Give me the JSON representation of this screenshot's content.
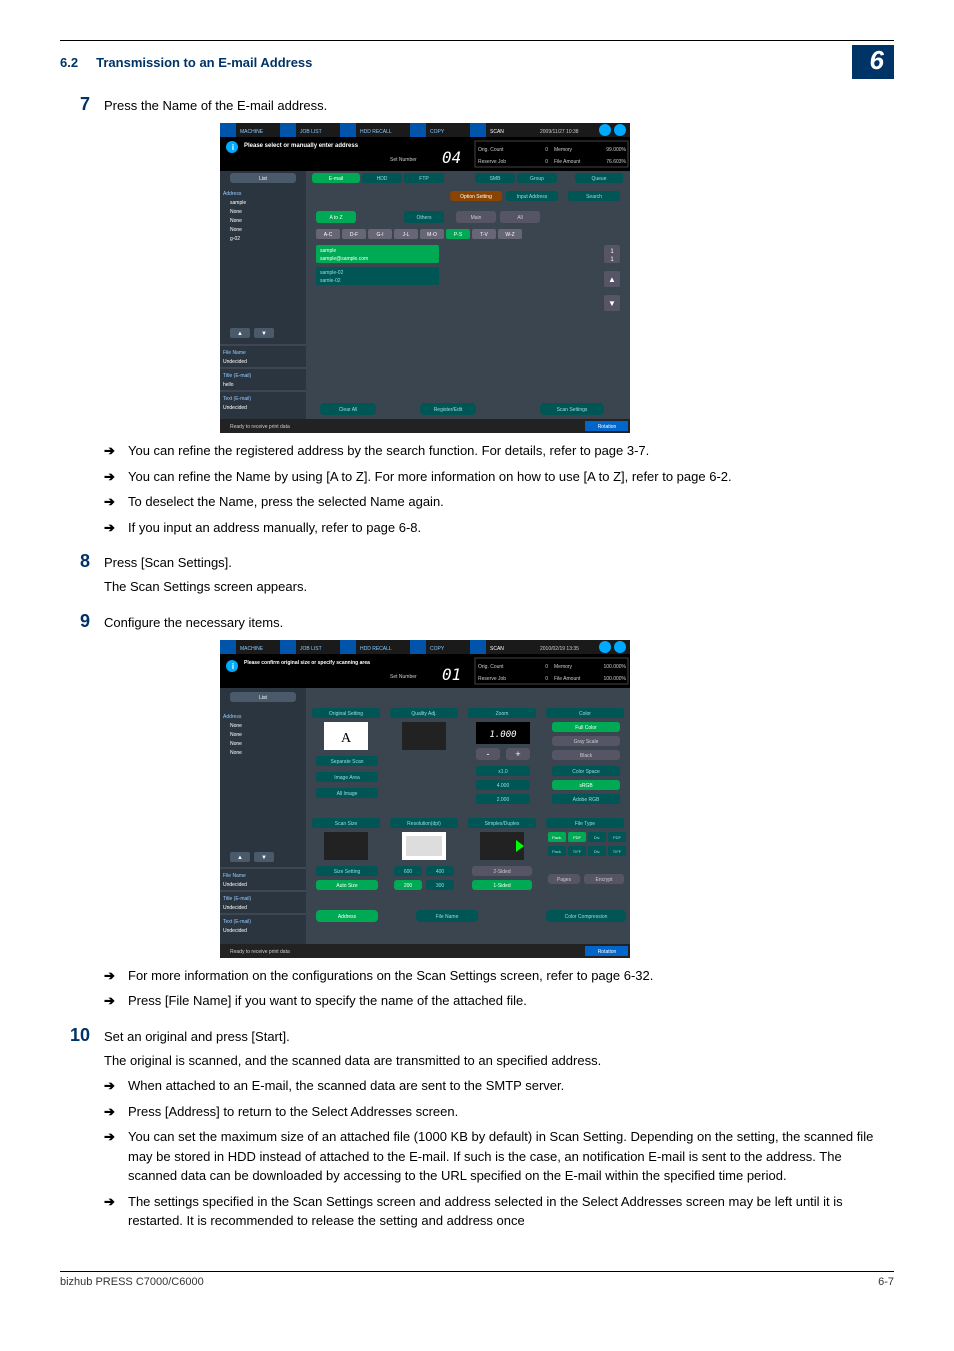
{
  "header": {
    "section_num": "6.2",
    "section_title": "Transmission to an E-mail Address",
    "chapter": "6"
  },
  "steps": [
    {
      "num": "7",
      "text": "Press the Name of the E-mail address.",
      "arrows": [
        "You can refine the registered address by the search function. For details, refer to page 3-7.",
        "You can refine the Name by using [A to Z]. For more information on how to use [A to Z], refer to page 6-2.",
        "To deselect the Name, press the selected Name again.",
        "If you input an address manually, refer to page 6-8."
      ]
    },
    {
      "num": "8",
      "text": "Press [Scan Settings].",
      "desc": "The Scan Settings screen appears."
    },
    {
      "num": "9",
      "text": "Configure the necessary items.",
      "arrows": [
        "For more information on the configurations on the Scan Settings screen, refer to page 6-32.",
        "Press [File Name] if you want to specify the name of the attached file."
      ]
    },
    {
      "num": "10",
      "text": "Set an original and press [Start].",
      "desc": "The original is scanned, and the scanned data are transmitted to an specified address.",
      "arrows": [
        "When attached to an E-mail, the scanned data are sent to the SMTP server.",
        "Press [Address] to return to the Select Addresses screen.",
        " You can set the maximum size of an attached file (1000 KB by default) in Scan Setting. Depending on the setting, the scanned file may be stored in HDD instead of attached to the E-mail. If such is the case, an notification E-mail is sent to the address. The scanned data can be downloaded by accessing to the URL specified on the E-mail within the specified time period.",
        "The settings specified in the Scan Settings screen and address selected in the Select Addresses screen may be left until it is restarted. It is recommended to release the setting and address once"
      ]
    }
  ],
  "screenshot1": {
    "topbar": {
      "machine": "MACHINE",
      "joblist": "JOB LIST",
      "hddrecall": "HDD RECALL",
      "copy": "COPY",
      "scan": "SCAN",
      "datetime": "2009/11/27 10:38"
    },
    "info_msg": "Please select or manually enter address",
    "set_number_label": "Set Number",
    "set_number_value": "04",
    "counts": {
      "orig_label": "Orig. Count",
      "orig_val": "0",
      "reserve_label": "Reserve Job",
      "reserve_val": "0",
      "mem_label": "Memory",
      "mem_val": "99.000%",
      "file_label": "File Amount",
      "file_val": "76.603%"
    },
    "list_btn": "List",
    "left_labels": {
      "address": "Address",
      "sample": "sample",
      "none1": "None",
      "none2": "None",
      "none3": "None",
      "g02": "g-02",
      "file_name_l": "File Name",
      "file_name_v": "Undecided",
      "title_l": "Title (E-mail)",
      "title_v": "hello",
      "text_l": "Text (E-mail)",
      "text_v": "Undecided"
    },
    "tabs": {
      "email": "E-mail",
      "hdd": "HDD",
      "ftp": "FTP",
      "smb": "SMB",
      "group": "Group",
      "queue": "Queue"
    },
    "option_setting": "Option Setting",
    "input_address": "Input Address",
    "search": "Search",
    "cat_tabs": {
      "atoz": "A to Z",
      "others": "Others",
      "main": "Main",
      "all": "All"
    },
    "alpha": {
      "ac": "A-C",
      "df": "D-F",
      "gi": "G-I",
      "jl": "J-L",
      "mo": "M-O",
      "ps": "P-S",
      "tv": "T-V",
      "wz": "W-Z"
    },
    "items": {
      "sample": "sample",
      "sample_addr": "sample@sample.com",
      "sample02": "sample-02",
      "sample02b": "samle-02"
    },
    "clear_all": "Clear All",
    "reg_edit": "Register/Edit",
    "scan_settings": "Scan Settings",
    "status": "Ready to receive print data",
    "rotation": "Rotation"
  },
  "screenshot2": {
    "topbar": {
      "machine": "MACHINE",
      "joblist": "JOB LIST",
      "hddrecall": "HDD RECALL",
      "copy": "COPY",
      "scan": "SCAN",
      "datetime": "2010/02/19 13:35"
    },
    "info_msg": "Please confirm original size or specify scanning area",
    "set_number_label": "Set Number",
    "set_number_value": "01",
    "counts": {
      "orig_label": "Orig. Count",
      "orig_val": "0",
      "reserve_label": "Reserve Job",
      "reserve_val": "0",
      "mem_label": "Memory",
      "mem_val": "100.000%",
      "file_label": "File Amount",
      "file_val": "100.000%"
    },
    "list_btn": "List",
    "left_labels": {
      "address": "Address",
      "none1": "None",
      "none2": "None",
      "none3": "None",
      "none4": "None",
      "file_name_l": "File Name",
      "file_name_v": "Undecided",
      "title_l": "Title (E-mail)",
      "title_v": "Undecided",
      "text_l": "Text (E-mail)",
      "text_v": "Undecided"
    },
    "panels": {
      "orig_setting": "Original Setting",
      "qual_adj": "Quality Adj.",
      "zoom": "Zoom",
      "color": "Color",
      "sep_scan": "Separate Scan",
      "image_area": "Image Area",
      "all_image": "All Image",
      "zoom_val": "1.000",
      "zoom_x1": "x1.0",
      "zoom_4000": "4.000",
      "zoom_2000": "2.000",
      "full_color": "Full Color",
      "gray_scale": "Gray Scale",
      "black": "Black",
      "color_space": "Color Space",
      "srgb": "sRGB",
      "adobe_rgb": "Adobe RGB",
      "scan_size": "Scan Size",
      "resolution": "Resolution(dpi)",
      "simp_dup": "Simplex/Duplex",
      "file_type": "File Type",
      "size_setting": "Size Setting",
      "auto_size": "Auto Size",
      "r600": "600",
      "r400": "400",
      "r200": "200",
      "r300": "300",
      "two_sided": "2-Sided",
      "one_sided": "1-Sided",
      "pack": "Pack.",
      "pdf": "PDF",
      "div": "Div.",
      "pdf2": "PDF",
      "pack2": "Pack.",
      "tiff": "TIFF",
      "div2": "Div.",
      "tiff2": "TIFF",
      "pages": "Pages",
      "encrypt": "Encrypt",
      "address": "Address",
      "file_name": "File Name",
      "color_comp": "Color Compression"
    },
    "status": "Ready to receive print data",
    "rotation": "Rotation"
  },
  "footer": {
    "left": "bizhub PRESS C7000/C6000",
    "right": "6-7"
  }
}
